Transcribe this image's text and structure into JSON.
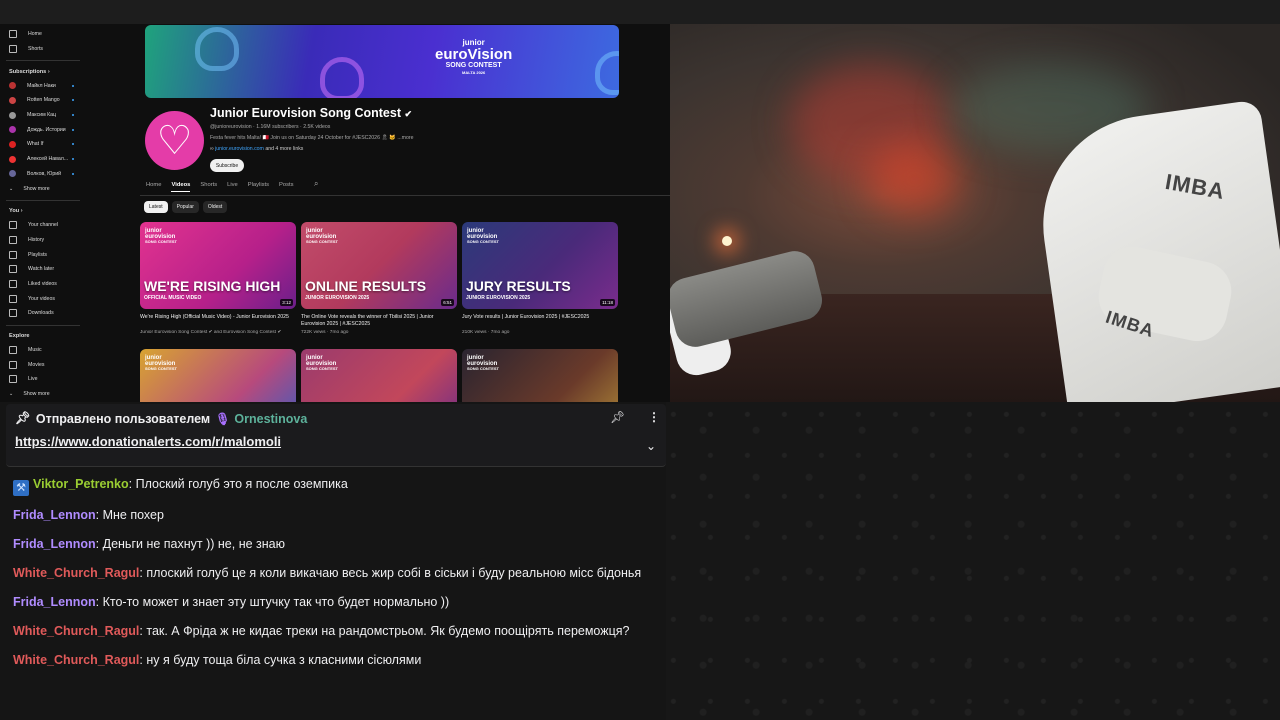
{
  "youtube": {
    "sidebar": {
      "top": [
        {
          "label": "Home",
          "icon": "home-icon"
        },
        {
          "label": "Shorts",
          "icon": "shorts-icon"
        }
      ],
      "subscriptions_title": "Subscriptions",
      "subscriptions": [
        {
          "label": "Майкл Наки",
          "color": "#b33"
        },
        {
          "label": "Rotten Mango",
          "color": "#c44"
        },
        {
          "label": "Максим Кац",
          "color": "#999"
        },
        {
          "label": "Дождь. Истории",
          "color": "#a3a"
        },
        {
          "label": "What If",
          "color": "#d22"
        },
        {
          "label": "Алексей Навал...",
          "color": "#e33"
        },
        {
          "label": "Волков, Юрий",
          "color": "#669"
        }
      ],
      "show_more": "Show more",
      "you_title": "You",
      "you": [
        {
          "label": "Your channel",
          "icon": "channel-icon"
        },
        {
          "label": "History",
          "icon": "history-icon"
        },
        {
          "label": "Playlists",
          "icon": "playlists-icon"
        },
        {
          "label": "Watch later",
          "icon": "watch-later-icon"
        },
        {
          "label": "Liked videos",
          "icon": "liked-icon"
        },
        {
          "label": "Your videos",
          "icon": "your-videos-icon"
        },
        {
          "label": "Downloads",
          "icon": "downloads-icon"
        }
      ],
      "explore_title": "Explore",
      "explore": [
        {
          "label": "Music",
          "icon": "music-icon"
        },
        {
          "label": "Movies",
          "icon": "movies-icon"
        },
        {
          "label": "Live",
          "icon": "live-icon"
        }
      ],
      "show_more2": "Show more"
    },
    "banner": {
      "line1": "junior",
      "line2": "euroVision",
      "line3": "SONG CONTEST",
      "line4": "MALTA 2026"
    },
    "channel": {
      "title": "Junior Eurovision Song Contest",
      "handle_meta": "@junioreurovision · 1.16M subscribers · 2.5K videos",
      "description": "Festa fever hits Malta! 🇲🇹 Join us on Saturday 24 October for #JESC2026 🎗 🐱 ...more",
      "link": "junior.eurovision.com",
      "link_more": "and 4 more links",
      "subscribe": "Subscribe"
    },
    "tabs": [
      "Home",
      "Videos",
      "Shorts",
      "Live",
      "Playlists",
      "Posts"
    ],
    "active_tab": "Videos",
    "chips": [
      "Latest",
      "Popular",
      "Oldest"
    ],
    "videos": [
      {
        "big": "WE'RE RISING HIGH",
        "sub": "OFFICIAL MUSIC VIDEO",
        "duration": "3:12",
        "title": "We're Rising High (Official Music Video) - Junior Eurovision 2025",
        "meta": "Junior Eurovision Song Contest ✔ and Eurovision Song Contest ✔",
        "bg": "linear-gradient(135deg,#e2338f,#b6208a 60%,#6b1f8a)"
      },
      {
        "big": "ONLINE RESULTS",
        "sub": "JUNIOR EUROVISION 2025",
        "duration": "6:51",
        "title": "The Online Vote reveals the winner of Tbilisi 2025 | Junior Eurovision 2025 | #JESC2025",
        "meta": "722K views · 7mo ago",
        "bg": "linear-gradient(135deg,#c24c6a,#b23a5d 50%,#6a2b8c)"
      },
      {
        "big": "JURY RESULTS",
        "sub": "JUNIOR EUROVISION 2025",
        "duration": "11:18",
        "title": "Jury Vote results | Junior Eurovision 2025 | #JESC2025",
        "meta": "210K views · 7mo ago",
        "bg": "linear-gradient(135deg,#2b3a7a,#4a2a7a 55%,#7a2c8c)"
      },
      {
        "big": "",
        "sub": "",
        "duration": "",
        "title": "",
        "meta": "",
        "bg": "linear-gradient(135deg,#d8a431,#b74a7c 60%,#3a5cc0)"
      },
      {
        "big": "",
        "sub": "",
        "duration": "",
        "title": "",
        "meta": "",
        "bg": "linear-gradient(135deg,#9b3b6d,#c2475b 60%,#6b2b8a)"
      },
      {
        "big": "",
        "sub": "",
        "duration": "",
        "title": "",
        "meta": "",
        "bg": "linear-gradient(135deg,#2a2430,#6a3a2a 60%,#b08a38)"
      }
    ],
    "thumb_logo": [
      "junior",
      "eurovision",
      "SONG CONTEST"
    ]
  },
  "cam": {
    "brand": "IMBA"
  },
  "pinned": {
    "prefix": "Отправлено пользователем",
    "user": "Ornestinova",
    "user_color": "#5db29b",
    "link": "https://www.donationalerts.com/r/malomoli"
  },
  "chat": [
    {
      "user": "Viktor_Petrenko",
      "color": "#9acd32",
      "badge": true,
      "text": "Плоский голуб это я после оземпика"
    },
    {
      "user": "Frida_Lennon",
      "color": "#b08cff",
      "badge": false,
      "text": "Мне похер"
    },
    {
      "user": "Frida_Lennon",
      "color": "#b08cff",
      "badge": false,
      "text": "Деньги не пахнут )) не, не знаю"
    },
    {
      "user": "White_Church_Ragul",
      "color": "#e05a5a",
      "badge": false,
      "text": "плоский голуб це я коли викачаю весь жир собі в сіськи і буду реальною місс бідонья"
    },
    {
      "user": "Frida_Lennon",
      "color": "#b08cff",
      "badge": false,
      "text": "Кто-то может и знает эту штучку так что будет нормально ))"
    },
    {
      "user": "White_Church_Ragul",
      "color": "#e05a5a",
      "badge": false,
      "text": "так. А Фріда ж не кидає треки на рандомстрьом. Як будемо поощірять переможця?"
    },
    {
      "user": "White_Church_Ragul",
      "color": "#e05a5a",
      "badge": false,
      "text": "ну я буду тоща біла сучка з класними сісюлями"
    }
  ]
}
